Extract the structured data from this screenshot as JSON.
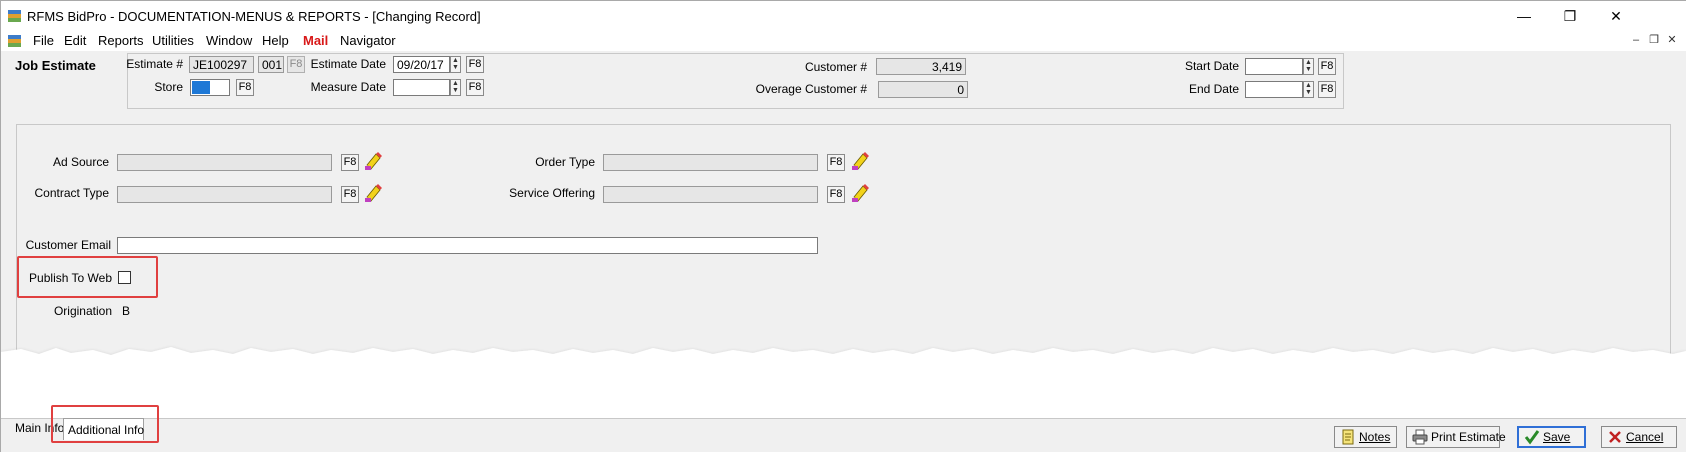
{
  "window": {
    "title": "RFMS BidPro - DOCUMENTATION-MENUS & REPORTS - [Changing Record]",
    "minimize_glyph": "—",
    "maximize_glyph": "❐",
    "close_glyph": "✕"
  },
  "menu": {
    "items": [
      "File",
      "Edit",
      "Reports",
      "Utilities",
      "Window",
      "Help",
      "Mail",
      "Navigator"
    ]
  },
  "mdi": {
    "minimize_glyph": "–",
    "restore_glyph": "❐",
    "close_glyph": "✕"
  },
  "header": {
    "section_title": "Job Estimate",
    "estimate_label": "Estimate #",
    "estimate_number": "JE100297",
    "estimate_suffix": "001",
    "f8": "F8",
    "store_label": "Store",
    "store_value": "",
    "estimate_date_label": "Estimate Date",
    "estimate_date_value": "09/20/17",
    "measure_date_label": "Measure Date",
    "measure_date_value": "",
    "customer_label": "Customer #",
    "customer_value": "3,419",
    "overage_customer_label": "Overage Customer #",
    "overage_customer_value": "0",
    "start_date_label": "Start Date",
    "start_date_value": "",
    "end_date_label": "End Date",
    "end_date_value": ""
  },
  "form": {
    "ad_source_label": "Ad Source",
    "ad_source_value": "",
    "contract_type_label": "Contract Type",
    "contract_type_value": "",
    "order_type_label": "Order Type",
    "order_type_value": "",
    "service_offering_label": "Service Offering",
    "service_offering_value": "",
    "customer_email_label": "Customer Email",
    "customer_email_value": "",
    "publish_to_web_label": "Publish To Web",
    "publish_to_web_checked": false,
    "origination_label": "Origination",
    "origination_value": "B"
  },
  "tabs": [
    {
      "label": "Main Info",
      "active": false
    },
    {
      "label": "Additional Info",
      "active": true
    }
  ],
  "buttons": {
    "notes": "Notes",
    "print_estimate": "Print Estimate",
    "save": "Save",
    "cancel": "Cancel"
  },
  "colors": {
    "highlight": "#e04040",
    "mail_menu": "#d81818",
    "default_button_border": "#2f6fd6"
  }
}
